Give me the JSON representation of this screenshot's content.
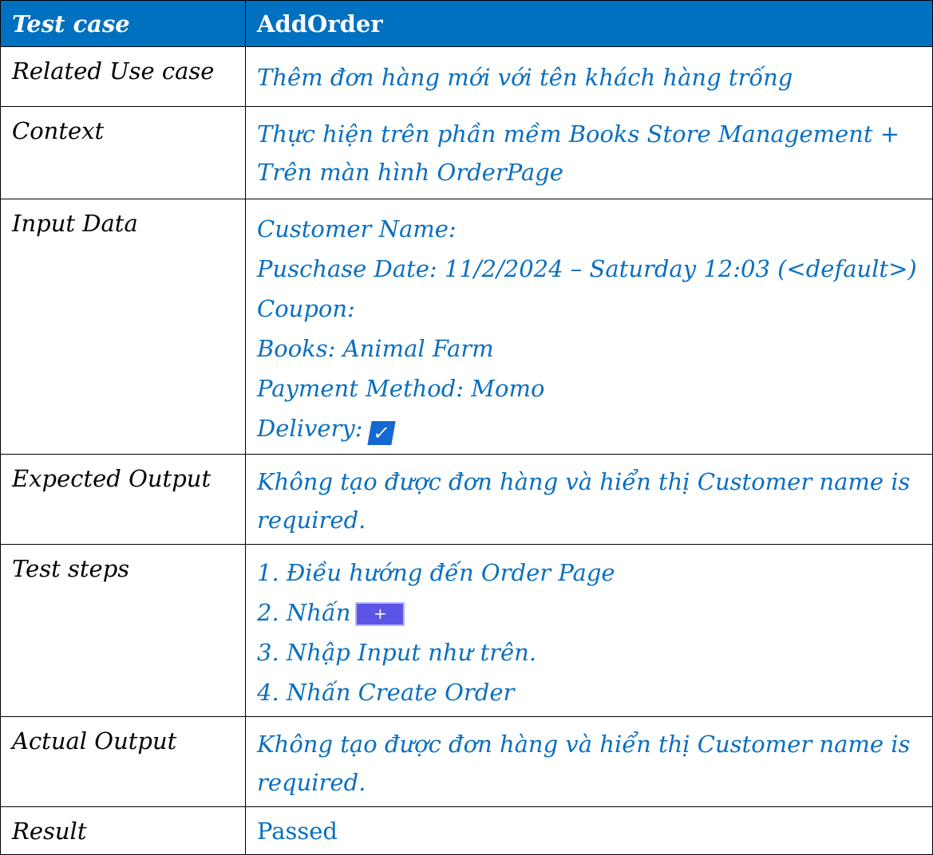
{
  "header": {
    "label": "Test case",
    "value": "AddOrder"
  },
  "rows": {
    "related_use_case": {
      "label": "Related Use case",
      "value": "Thêm đơn hàng mới với tên khách hàng trống"
    },
    "context": {
      "label": "Context",
      "lines": [
        "Thực hiện trên phần mềm Books Store Management +",
        "Trên màn hình OrderPage"
      ]
    },
    "input_data": {
      "label": "Input Data",
      "lines": [
        "Customer  Name:",
        "Puschase Date: 11/2/2024 – Saturday 12:03 (<default>)",
        "Coupon:",
        "Books: Animal Farm",
        "Payment Method: Momo",
        "Delivery:"
      ],
      "delivery_checked": true
    },
    "expected_output": {
      "label": "Expected Output",
      "lines": [
        "Không tạo được đơn hàng và hiển thị Customer name is",
        "required."
      ]
    },
    "test_steps": {
      "label": "Test steps",
      "lines": [
        "1. Điều hướng đến Order Page",
        "2. Nhấn",
        "3. Nhập Input như trên.",
        "4. Nhấn Create Order"
      ],
      "add_button_symbol": "+"
    },
    "actual_output": {
      "label": "Actual Output",
      "lines": [
        "Không tạo được đơn hàng và hiển thị Customer name is",
        "required."
      ]
    },
    "result": {
      "label": "Result",
      "value": "Passed"
    }
  },
  "colors": {
    "header_bg": "#0070c0",
    "value_text": "#0a6fbf",
    "passed": "#ff0000"
  },
  "icons": {
    "delivery": "checkbox-checked-icon",
    "add": "plus-button-icon"
  }
}
